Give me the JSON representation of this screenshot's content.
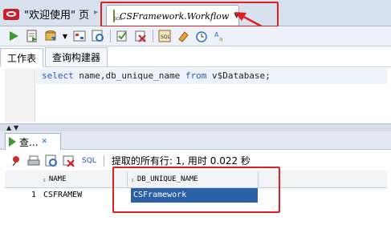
{
  "tabs": [
    {
      "label": "\"欢迎使用\" 页",
      "icon": "oracle-icon"
    },
    {
      "label": "CSFramework.Workflow",
      "icon": "sql-worksheet-icon"
    }
  ],
  "subtabs": [
    "工作表",
    "查询构建器"
  ],
  "editor": {
    "sql": [
      {
        "t": "select ",
        "c": "kw"
      },
      {
        "t": "name",
        "c": "id"
      },
      {
        "t": ",",
        "c": "id"
      },
      {
        "t": "db_unique_name ",
        "c": "id"
      },
      {
        "t": "from ",
        "c": "kw"
      },
      {
        "t": "v$Database",
        "c": "id"
      },
      {
        "t": ";",
        "c": "id"
      }
    ]
  },
  "results": {
    "tab_label": "查...",
    "sql_label": "SQL",
    "status": "提取的所有行: 1, 用时 0.022 秒",
    "columns": [
      "NAME",
      "DB_UNIQUE_NAME"
    ],
    "rows": [
      {
        "n": "1",
        "cells": [
          "CSFRAMEW",
          "CSFramework"
        ]
      }
    ]
  },
  "colors": {
    "annotation": "#e02020",
    "selection": "#2b5fa6",
    "run": "#3c9a30"
  }
}
